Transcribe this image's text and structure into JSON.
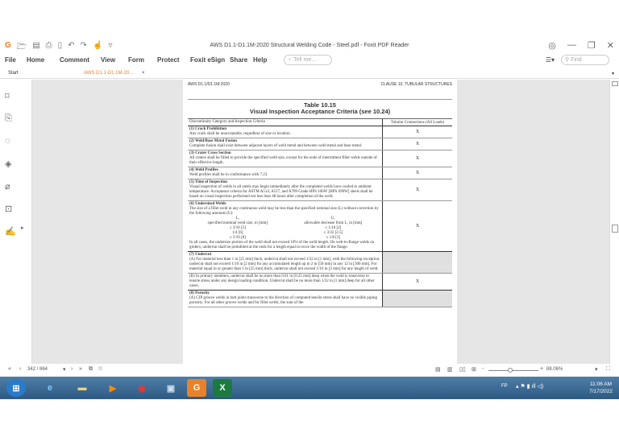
{
  "window": {
    "title": "AWS D1.1-D1.1M-2020 Structural Welding Code - Steel.pdf - Foxit PDF Reader"
  },
  "menu": [
    "File",
    "Home",
    "Comment",
    "View",
    "Form",
    "Protect",
    "Foxit eSign",
    "Share",
    "Help"
  ],
  "tell_me": "Tell me...",
  "find": "Find",
  "tabs": {
    "start": "Start",
    "doc": "AWS D1.1-D1.1M-20...",
    "close": "×"
  },
  "page": {
    "header_left": "AWS D1.1/D1.1M:2020",
    "header_right": "CLAUSE 10. TUBULAR STRUCTURES",
    "table_title": "Table 10.15",
    "table_subtitle": "Visual Inspection Acceptance Criteria (see 10.24)",
    "col1": "Discontinuity Category and Inspection Criteria",
    "col2": "Tubular Connections (All Loads)",
    "rows": [
      {
        "h": "(1) Crack Prohibition",
        "t": "Any crack shall be unacceptable, regardless of size or location.",
        "x": "X"
      },
      {
        "h": "(2) Weld/Base Metal Fusion",
        "t": "Complete fusion shall exist between adjacent layers of weld metal and between weld metal and base metal.",
        "x": "X"
      },
      {
        "h": "(3) Crater Cross Section",
        "t": "All craters shall be filled to provide the specified weld size, except for the ends of intermittent fillet welds outside of their effective length.",
        "x": "X"
      },
      {
        "h": "(4) Weld Profiles",
        "t": "Weld profiles shall be in conformance with 7.23.",
        "x": "X"
      },
      {
        "h": "(5) Time of Inspection",
        "t": "Visual inspection of welds in all steels may begin immediately after the completed welds have cooled to ambient temperature. Acceptance criteria for ASTM A514, A517, and A709 Grade HPS 100W [HPS 690W] steels shall be based on visual inspection performed not less than 48 hours after completion of the weld.",
        "x": "X"
      }
    ],
    "undersized": {
      "h": "(6) Undersized Welds",
      "t": "The size of a fillet weld in any continuous weld may be less than the specified nominal size (L) without correction by the following amounts (U):",
      "l_head": "L,",
      "l_sub": "specified nominal weld size, in [mm]",
      "u_head": "U,",
      "u_sub": "allowable decrease from L, in [mm]",
      "l_vals": [
        "≤ 3/16 [5]",
        "1/4 [6]",
        "≥ 5/16 [8]"
      ],
      "u_vals": [
        "≤ 1/16 [2]",
        "≤ 3/32 [2.5]",
        "≤ 1/8 [3]"
      ],
      "t2": "In all cases, the undersize portion of the weld shall not exceed 10% of the weld length. On web-to-flange welds on girders, underrun shall be prohibited at the ends for a length equal to twice the width of the flange.",
      "x": "X"
    },
    "undercut": {
      "h": "(7) Undercut",
      "a": "(A) For material less than 1 in [25 mm] thick, undercut shall not exceed 1/32 in [1 mm], with the following exception: undercut shall not exceed 1/16 in [2 mm] for any accumulated length up to 2 in [50 mm] in any 12 in [300 mm]. For material equal to or greater than 1 in [25 mm] thick, undercut shall not exceed 1/16 in [2 mm] for any length of weld.",
      "b": "(B) In primary members, undercut shall be no more than 0.01 in [0.25 mm] deep when the weld is transverse to tensile stress under any design loading condition. Undercut shall be no more than 1/32 in [1 mm] deep for all other cases.",
      "x": "X"
    },
    "porosity": {
      "h": "(8) Porosity",
      "a": "(A) CJP groove welds in butt joints transverse to the direction of computed tensile stress shall have no visible piping porosity. For all other groove welds and for fillet welds, the sum of the"
    }
  },
  "status": {
    "page": "342 / 864",
    "zoom": "88.06%"
  },
  "clock": {
    "time": "11:06 AM",
    "date": "7/17/2022",
    "lang": "FP"
  }
}
